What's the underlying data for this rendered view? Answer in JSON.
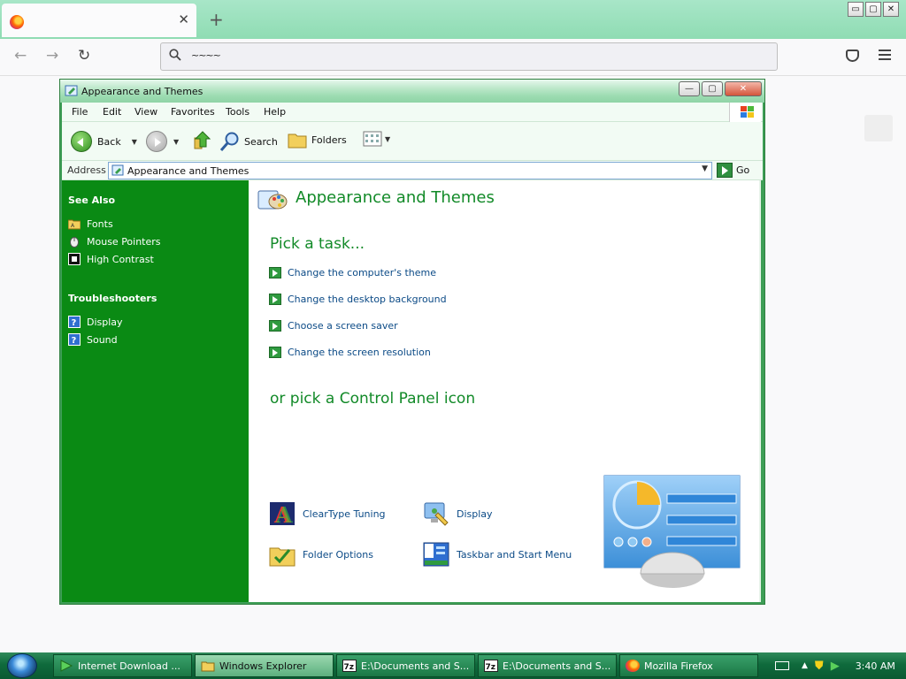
{
  "browser": {
    "tab": {
      "title": "",
      "close": "✕"
    },
    "new_tab": "+",
    "url": "~~~~",
    "window_buttons": [
      "▭",
      "▢",
      "✕"
    ],
    "nav": {
      "back": "←",
      "forward": "→",
      "reload": "↻"
    }
  },
  "explorer": {
    "title": "Appearance and Themes",
    "window_buttons": {
      "min": "—",
      "max": "▢",
      "close": "✕"
    },
    "menu": [
      "File",
      "Edit",
      "View",
      "Favorites",
      "Tools",
      "Help"
    ],
    "toolbar": {
      "back": "Back",
      "search": "Search",
      "folders": "Folders"
    },
    "address": {
      "label": "Address",
      "value": "Appearance and Themes",
      "go": "Go"
    },
    "sidebar": {
      "see_also_title": "See Also",
      "see_also": [
        "Fonts",
        "Mouse Pointers",
        "High Contrast"
      ],
      "troubleshooters_title": "Troubleshooters",
      "troubleshooters": [
        "Display",
        "Sound"
      ]
    },
    "main": {
      "title": "Appearance and Themes",
      "pick_task": "Pick a task...",
      "tasks": [
        "Change the computer's theme",
        "Change the desktop background",
        "Choose a screen saver",
        "Change the screen resolution"
      ],
      "pick_icon": "or pick a Control Panel icon",
      "icons": [
        "ClearType Tuning",
        "Display",
        "Folder Options",
        "Taskbar and Start Menu"
      ]
    }
  },
  "taskbar": {
    "buttons": [
      "Internet Download ...",
      "Windows Explorer",
      "E:\\Documents and S...",
      "E:\\Documents and S...",
      "Mozilla Firefox"
    ],
    "clock": "3:40 AM"
  },
  "colors": {
    "xp_green": "#0a8a14",
    "heading_green": "#128a28",
    "link_blue": "#0b4a86"
  }
}
